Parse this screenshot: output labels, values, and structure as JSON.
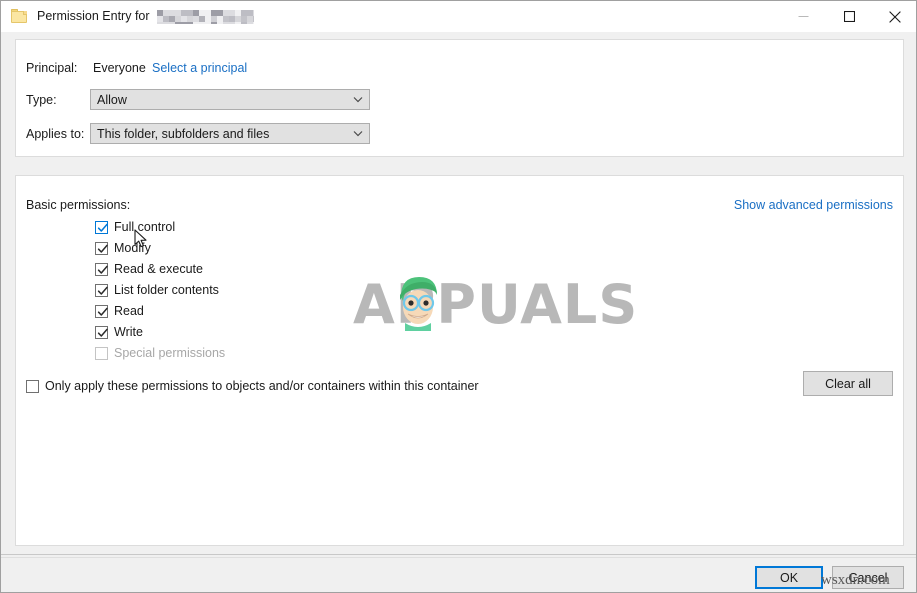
{
  "window": {
    "title": "Permission Entry for",
    "title_redacted": true,
    "icon": "folder-icon",
    "controls": {
      "minimize": "minimize-icon",
      "maximize": "maximize-icon",
      "close": "close-icon"
    }
  },
  "top_panel": {
    "principal_label": "Principal:",
    "principal_value": "Everyone",
    "select_principal_link": "Select a principal",
    "type_label": "Type:",
    "type_value": "Allow",
    "applies_to_label": "Applies to:",
    "applies_to_value": "This folder, subfolders and files"
  },
  "main_panel": {
    "basic_permissions_label": "Basic permissions:",
    "show_advanced_link": "Show advanced permissions",
    "permissions": [
      {
        "label": "Full control",
        "checked": true,
        "disabled": false,
        "hover": true
      },
      {
        "label": "Modify",
        "checked": true,
        "disabled": false,
        "hover": false
      },
      {
        "label": "Read & execute",
        "checked": true,
        "disabled": false,
        "hover": false
      },
      {
        "label": "List folder contents",
        "checked": true,
        "disabled": false,
        "hover": false
      },
      {
        "label": "Read",
        "checked": true,
        "disabled": false,
        "hover": false
      },
      {
        "label": "Write",
        "checked": true,
        "disabled": false,
        "hover": false
      },
      {
        "label": "Special permissions",
        "checked": false,
        "disabled": true,
        "hover": false
      }
    ],
    "only_apply_label": "Only apply these permissions to objects and/or containers within this container",
    "only_apply_checked": false,
    "clear_all_label": "Clear all"
  },
  "footer": {
    "ok_label": "OK",
    "cancel_label": "Cancel",
    "ok_focused": true
  },
  "watermarks": {
    "brand": "APPUALS",
    "site": "wsxdn.com"
  },
  "colors": {
    "link": "#1a6fc4",
    "accent": "#0078d7",
    "dialog_bg": "#f0f0f0",
    "panel_bg": "#ffffff",
    "control_bg": "#e1e1e1"
  }
}
